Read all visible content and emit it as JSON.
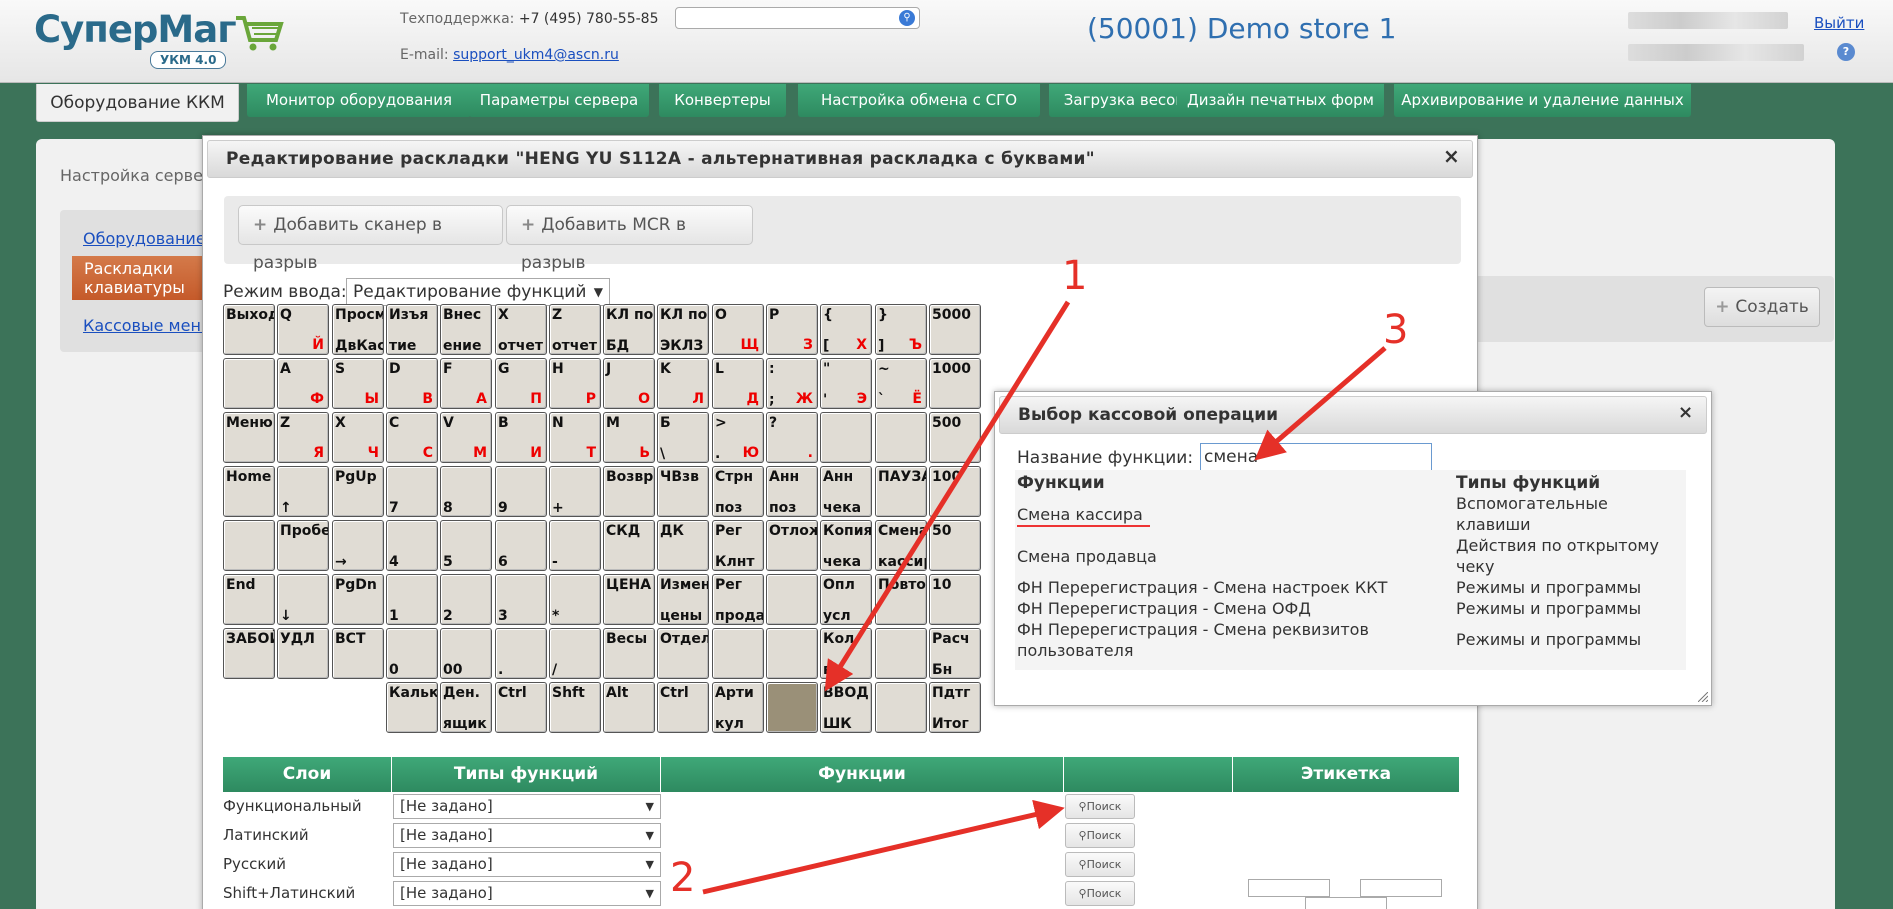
{
  "header": {
    "logo_text": "СуперМаг",
    "logo_badge": "УКМ 4.0",
    "support_label": "Техподдержка: ",
    "support_phone": "+7 (495) 780-55-85",
    "email_label": "E-mail: ",
    "email": "support_ukm4@ascn.ru",
    "search_placeholder": "",
    "store_title": "(50001) Demo store 1",
    "logout": "Выйти",
    "help": "?"
  },
  "nav": {
    "tabs": [
      {
        "label": "Оборудование ККМ",
        "active": true
      },
      {
        "label": "Монитор оборудования"
      },
      {
        "label": "Параметры сервера"
      },
      {
        "label": "Конвертеры"
      },
      {
        "label": "Настройка обмена с СГО"
      },
      {
        "label": "Загрузка весов"
      },
      {
        "label": "Дизайн печатных форм"
      },
      {
        "label": "Архивирование и удаление данных"
      }
    ]
  },
  "page": {
    "breadcrumb": "Настройка серверн",
    "sidebar": [
      "Оборудование",
      "Раскладки клавиатуры",
      "Кассовые меню"
    ],
    "create_button": "Создать"
  },
  "layout_dialog": {
    "title": "Редактирование раскладки \"HENG YU S112A - альтернативная раскладка с буквами\"",
    "close": "×",
    "add_scanner": "Добавить сканер в разрыв",
    "add_mcr": "Добавить MCR в разрыв",
    "mode_label": "Режим ввода:",
    "mode_value": "Редактирование функций",
    "keys": [
      [
        [
          "Выход",
          ""
        ],
        [
          "Q",
          "",
          "Й"
        ],
        [
          "Просм",
          "ДвКас"
        ],
        [
          "Изъя",
          "тие"
        ],
        [
          "Внес",
          "ение"
        ],
        [
          "X",
          "отчет"
        ],
        [
          "Z",
          "отчет"
        ],
        [
          "КЛ по",
          "БД"
        ],
        [
          "КЛ по",
          "ЭКЛЗ"
        ],
        [
          "O",
          "",
          "Щ"
        ],
        [
          "P",
          "",
          "З"
        ],
        [
          "{",
          "[",
          "Х"
        ],
        [
          "}",
          "]",
          "Ъ"
        ],
        [
          "5000",
          ""
        ]
      ],
      [
        [
          "",
          ""
        ],
        [
          "A",
          "",
          "Ф"
        ],
        [
          "S",
          "",
          "Ы"
        ],
        [
          "D",
          "",
          "В"
        ],
        [
          "F",
          "",
          "А"
        ],
        [
          "G",
          "",
          "П"
        ],
        [
          "H",
          "",
          "Р"
        ],
        [
          "J",
          "",
          "О"
        ],
        [
          "K",
          "",
          "Л"
        ],
        [
          "L",
          "",
          "Д"
        ],
        [
          ":",
          ";",
          "Ж"
        ],
        [
          "\"",
          "'",
          "Э"
        ],
        [
          "~",
          "`",
          "Ё"
        ],
        [
          "1000",
          ""
        ]
      ],
      [
        [
          "Меню",
          ""
        ],
        [
          "Z",
          "",
          "Я"
        ],
        [
          "X",
          "",
          "Ч"
        ],
        [
          "C",
          "",
          "С"
        ],
        [
          "V",
          "",
          "М"
        ],
        [
          "B",
          "",
          "И"
        ],
        [
          "N",
          "",
          "Т"
        ],
        [
          "M",
          "",
          "Ь"
        ],
        [
          "Б",
          "\\"
        ],
        [
          ">",
          ".",
          "Ю"
        ],
        [
          "?",
          "",
          ". "
        ],
        [
          "",
          ""
        ],
        [
          "",
          ""
        ],
        [
          "500",
          ""
        ]
      ],
      [
        [
          "Home",
          ""
        ],
        [
          "",
          "↑"
        ],
        [
          "PgUp",
          ""
        ],
        [
          "",
          "7"
        ],
        [
          "",
          "8"
        ],
        [
          "",
          "9"
        ],
        [
          "",
          "+"
        ],
        [
          "Возвр",
          ""
        ],
        [
          "ЧВзв",
          ""
        ],
        [
          "Стрн",
          "поз"
        ],
        [
          "Анн",
          "поз"
        ],
        [
          "Анн",
          "чека"
        ],
        [
          "ПАУЗА",
          ""
        ],
        [
          "100",
          ""
        ]
      ],
      [
        [
          "",
          ""
        ],
        [
          "Пробел",
          ""
        ],
        [
          "",
          "→"
        ],
        [
          "",
          "4"
        ],
        [
          "",
          "5"
        ],
        [
          "",
          "6"
        ],
        [
          "",
          "-"
        ],
        [
          "СКД",
          ""
        ],
        [
          "ДК",
          ""
        ],
        [
          "Рег",
          "Клнт"
        ],
        [
          "Отлож",
          ""
        ],
        [
          "Копия",
          "чека"
        ],
        [
          "Смена",
          "кассир"
        ],
        [
          "50",
          ""
        ]
      ],
      [
        [
          "End",
          ""
        ],
        [
          "",
          "↓"
        ],
        [
          "PgDn",
          ""
        ],
        [
          "",
          "1"
        ],
        [
          "",
          "2"
        ],
        [
          "",
          "3"
        ],
        [
          "",
          "*"
        ],
        [
          "ЦЕНА",
          ""
        ],
        [
          "Измен",
          "цены"
        ],
        [
          "Рег",
          "продав"
        ],
        [
          "",
          ""
        ],
        [
          "Опл",
          "усл"
        ],
        [
          "Повтор",
          ""
        ],
        [
          "10",
          ""
        ]
      ],
      [
        [
          "ЗАБОЙ",
          ""
        ],
        [
          "УДЛ",
          ""
        ],
        [
          "ВСТ",
          ""
        ],
        [
          "",
          "0"
        ],
        [
          "",
          "00"
        ],
        [
          "",
          "."
        ],
        [
          "",
          "/"
        ],
        [
          "Весы",
          ""
        ],
        [
          "Отдел",
          ""
        ],
        [
          "",
          ""
        ],
        [
          "",
          ""
        ],
        [
          "Кол-",
          "во"
        ],
        [
          "",
          ""
        ],
        [
          "Расч",
          "Бн"
        ]
      ],
      [
        [
          "Кальк",
          ""
        ],
        [
          "Ден.",
          "ящик"
        ],
        [
          "Ctrl",
          ""
        ],
        [
          "Shft",
          ""
        ],
        [
          "Alt",
          ""
        ],
        [
          "Ctrl",
          ""
        ],
        [
          "Арти",
          "кул"
        ],
        [
          "",
          ""
        ],
        [
          "ВВОД",
          "ШК"
        ],
        [
          "",
          ""
        ],
        [
          "Пдтг",
          "Итог"
        ]
      ]
    ],
    "layers_header": [
      "Слои",
      "Типы функций",
      "Функции",
      "",
      "Этикетка"
    ],
    "layers": [
      {
        "name": "Функциональный",
        "type": "[Не задано]",
        "search": "Поиск"
      },
      {
        "name": "Латинский",
        "type": "[Не задано]",
        "search": "Поиск"
      },
      {
        "name": "Русский",
        "type": "[Не задано]",
        "search": "Поиск"
      },
      {
        "name": "Shift+Латинский",
        "type": "[Не задано]",
        "search": "Поиск"
      }
    ]
  },
  "op_dialog": {
    "title": "Выбор кассовой операции",
    "close": "×",
    "name_label": "Название функции:",
    "name_value": "смена",
    "col_functions": "Функции",
    "col_types": "Типы функций",
    "rows": [
      {
        "fn": "Смена кассира",
        "type": "Вспомогательные клавиши"
      },
      {
        "fn": "Смена продавца",
        "type": "Действия по открытому чеку"
      },
      {
        "fn": "ФН Перерегистрация - Смена настроек ККТ",
        "type": "Режимы и программы"
      },
      {
        "fn": "ФН Перерегистрация - Смена ОФД",
        "type": "Режимы и программы"
      },
      {
        "fn": "ФН Перерегистрация - Смена реквизитов пользователя",
        "type": "Режимы и программы"
      }
    ]
  },
  "annotations": {
    "n1": "1",
    "n2": "2",
    "n3": "3",
    "color": "#e53028"
  }
}
